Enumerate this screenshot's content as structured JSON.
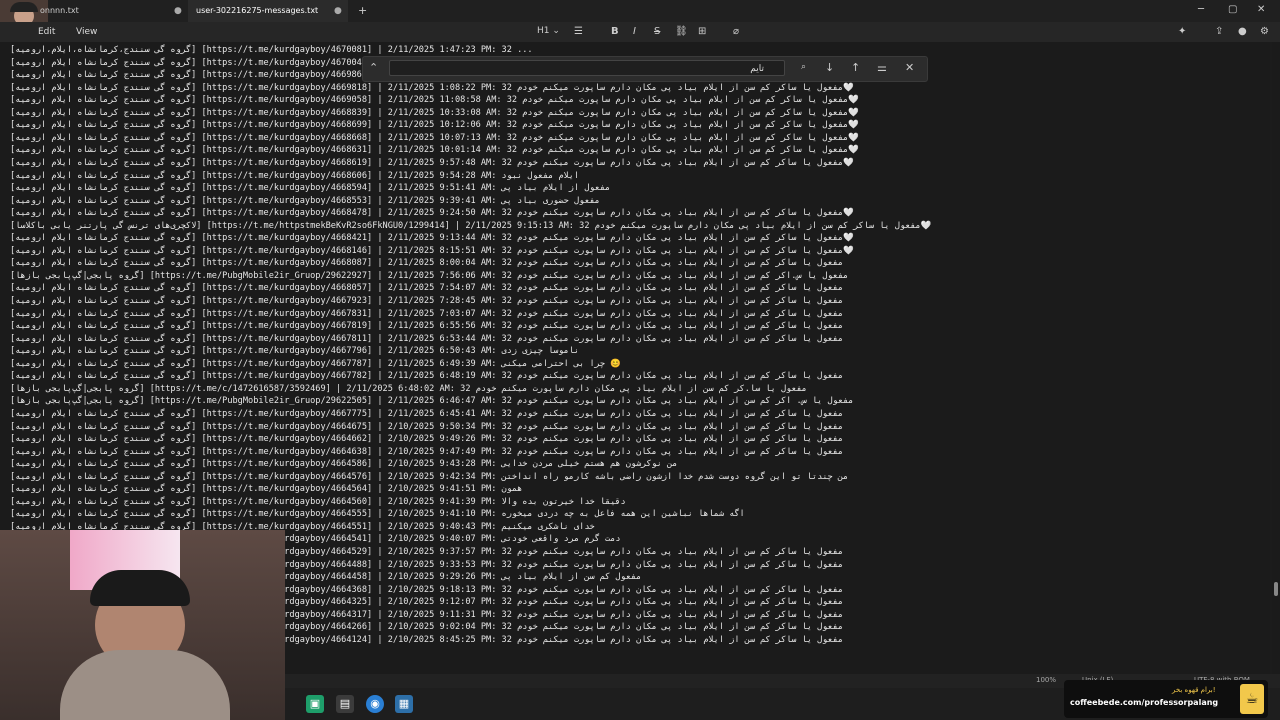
{
  "tabs": [
    {
      "label": "onnnn.txt"
    },
    {
      "label": "user-302216275-messages.txt"
    }
  ],
  "menu": {
    "edit": "Edit",
    "view": "View"
  },
  "toolbar": {
    "heading": "H1 ⌄"
  },
  "find": {
    "value": "تایم"
  },
  "editor_lines": [
    {
      "text": "[گروه گی سنندج،کرمانشاه،ایلام،ارومیه] [https://t.me/kurdgayboy/4670081] | 2/11/2025 1:47:23 PM: 32 ..."
    },
    {
      "text": "[گروه گی سنندج کرمانشاه ایلام ارومیه] [https://t.me/kurdgayboy/4670048] | 2/1"
    },
    {
      "text": "[گروه گی سنندج کرمانشاه ایلام ارومیه] [https://t.me/kurdgayboy/4669861] | 2/1"
    },
    {
      "text": "[گروه گی سنندج کرمانشاه ایلام ارومیه] [https://t.me/kurdgayboy/4669818] | 2/11/2025 1:08:22 PM: مفعول یا ساکر کم سن از ایلام بیاد پی مکان دارم ساپورت میکنم خودم 32🤍"
    },
    {
      "text": "[گروه گی سنندج کرمانشاه ایلام ارومیه] [https://t.me/kurdgayboy/4669058] | 2/11/2025 11:08:58 AM: مفعول یا ساکر کم سن از ایلام بیاد پی مکان دارم ساپورت میکنم خودم 32🤍"
    },
    {
      "text": "[گروه گی سنندج کرمانشاه ایلام ارومیه] [https://t.me/kurdgayboy/4668839] | 2/11/2025 10:33:08 AM: مفعول یا ساکر کم سن از ایلام بیاد پی مکان دارم ساپورت میکنم خودم 32🤍"
    },
    {
      "text": "[گروه گی سنندج کرمانشاه ایلام ارومیه] [https://t.me/kurdgayboy/4668699] | 2/11/2025 10:12:06 AM: مفعول یا ساکر کم سن از ایلام بیاد پی مکان دارم ساپورت میکنم خودم 32🤍"
    },
    {
      "text": "[گروه گی سنندج کرمانشاه ایلام ارومیه] [https://t.me/kurdgayboy/4668668] | 2/11/2025 10:07:13 AM: مفعول یا ساکر کم سن از ایلام بیاد پی مکان دارم ساپورت میکنم خودم 32🤍"
    },
    {
      "text": "[گروه گی سنندج کرمانشاه ایلام ارومیه] [https://t.me/kurdgayboy/4668631] | 2/11/2025 10:01:14 AM: مفعول یا ساکر کم سن از ایلام بیاد پی مکان دارم ساپورت میکنم خودم 32🤍"
    },
    {
      "text": "[گروه گی سنندج کرمانشاه ایلام ارومیه] [https://t.me/kurdgayboy/4668619] | 2/11/2025 9:57:48 AM: مفعول یا ساکر کم سن از ایلام بیاد پی مکان دارم ساپورت میکنم خودم 32🤍"
    },
    {
      "text": "[گروه گی سنندج کرمانشاه ایلام ارومیه] [https://t.me/kurdgayboy/4668606] | 2/11/2025 9:54:28 AM: ایلام مفعول نبود"
    },
    {
      "text": "[گروه گی سنندج کرمانشاه ایلام ارومیه] [https://t.me/kurdgayboy/4668594] | 2/11/2025 9:51:41 AM: مفعول از ایلام بیاد پی"
    },
    {
      "text": "[گروه گی سنندج کرمانشاه ایلام ارومیه] [https://t.me/kurdgayboy/4668553] | 2/11/2025 9:39:41 AM: مفعول حضوری بیاد پی"
    },
    {
      "text": "[گروه گی سنندج کرمانشاه ایلام ارومیه] [https://t.me/kurdgayboy/4668478] | 2/11/2025 9:24:50 AM: مفعول یا ساکر کم سن از ایلام بیاد پی مکان دارم ساپورت میکنم خودم 32🤍"
    },
    {
      "text": "[لاکچری‌های ترنس گی پارتنر یابی باکلاسا] [https://t.me/httpstmekBeKvR2so6FkNGU0/1299414] | 2/11/2025 9:15:13 AM: مفعول یا ساکر کم سن از ایلام بیاد پی مکان دارم ساپورت میکنم خودم 32🤍"
    },
    {
      "text": "[گروه گی سنندج کرمانشاه ایلام ارومیه] [https://t.me/kurdgayboy/4668421] | 2/11/2025 9:13:44 AM: مفعول یا ساکر کم سن از ایلام بیاد پی مکان دارم ساپورت میکنم خودم 32🤍"
    },
    {
      "text": "[گروه گی سنندج کرمانشاه ایلام ارومیه] [https://t.me/kurdgayboy/4668146] | 2/11/2025 8:15:51 AM: مفعول یا ساکر کم سن از ایلام بیاد پی مکان دارم ساپورت میکنم خودم 32🤍"
    },
    {
      "text": "[گروه گی سنندج کرمانشاه ایلام ارومیه] [https://t.me/kurdgayboy/4668087] | 2/11/2025 8:00:04 AM: مفعول یا ساکر کم سن از ایلام بیاد پی مکان دارم ساپورت میکنم خودم 32"
    },
    {
      "text": "[گروه پابجی|گپ‌پابجی بازها] [https://t.me/PubgMobile2ir_Gruop/29622927] | 2/11/2025 7:56:06 AM: مفعول یا س.اکر کم سن از ایلام بیاد پی مکان دارم ساپورت میکنم خودم 32"
    },
    {
      "text": "[گروه گی سنندج کرمانشاه ایلام ارومیه] [https://t.me/kurdgayboy/4668057] | 2/11/2025 7:54:07 AM: مفعول یا ساکر کم سن از ایلام بیاد پی مکان دارم ساپورت میکنم خودم 32"
    },
    {
      "text": "[گروه گی سنندج کرمانشاه ایلام ارومیه] [https://t.me/kurdgayboy/4667923] | 2/11/2025 7:28:45 AM: مفعول یا ساکر کم سن از ایلام بیاد پی مکان دارم ساپورت میکنم خودم 32"
    },
    {
      "text": "[گروه گی سنندج کرمانشاه ایلام ارومیه] [https://t.me/kurdgayboy/4667831] | 2/11/2025 7:03:07 AM: مفعول یا ساکر کم سن از ایلام بیاد پی مکان دارم ساپورت میکنم خودم 32"
    },
    {
      "text": "[گروه گی سنندج کرمانشاه ایلام ارومیه] [https://t.me/kurdgayboy/4667819] | 2/11/2025 6:55:56 AM: مفعول یا ساکر کم سن از ایلام بیاد پی مکان دارم ساپورت میکنم خودم 32"
    },
    {
      "text": "[گروه گی سنندج کرمانشاه ایلام ارومیه] [https://t.me/kurdgayboy/4667811] | 2/11/2025 6:53:44 AM: مفعول یا ساکر کم سن از ایلام بیاد پی مکان دارم ساپورت میکنم خودم 32"
    },
    {
      "text": "[گروه گی سنندج کرمانشاه ایلام ارومیه] [https://t.me/kurdgayboy/4667796] | 2/11/2025 6:50:43 AM: ناموسا چیزی زدی"
    },
    {
      "text": "[گروه گی سنندج کرمانشاه ایلام ارومیه] [https://t.me/kurdgayboy/4667787] | 2/11/2025 6:49:39 AM: چرا بی احترامی میکنی 😊"
    },
    {
      "text": "[گروه گی سنندج کرمانشاه ایلام ارومیه] [https://t.me/kurdgayboy/4667782] | 2/11/2025 6:48:19 AM: مفعول یا ساکر کم سن از ایلام بیاد پی مکان دارم ساپورت میکنم خودم 32"
    },
    {
      "text": "[گروه پابجی|گپ‌پابجی بازها] [https://t.me/c/1472616587/3592469] | 2/11/2025 6:48:02 AM: مفعول یا سا.کر کم سن از ایلام بیاد پی مکان دارم ساپورت میکنم خودم 32"
    },
    {
      "text": "[گروه پابجی|گپ‌پابجی بازها] [https://t.me/PubgMobile2ir_Gruop/29622505] | 2/11/2025 6:46:47 AM: مفعول یا س. اکر کم سن از ایلام بیاد پی مکان دارم ساپورت میکنم خودم 32"
    },
    {
      "text": "[گروه گی سنندج کرمانشاه ایلام ارومیه] [https://t.me/kurdgayboy/4667775] | 2/11/2025 6:45:41 AM: مفعول یا ساکر کم سن از ایلام بیاد پی مکان دارم ساپورت میکنم خودم 32"
    },
    {
      "text": "[گروه گی سنندج کرمانشاه ایلام ارومیه] [https://t.me/kurdgayboy/4664675] | 2/10/2025 9:50:34 PM: مفعول یا ساکر کم سن از ایلام بیاد پی مکان دارم ساپورت میکنم خودم 32"
    },
    {
      "text": "[گروه گی سنندج کرمانشاه ایلام ارومیه] [https://t.me/kurdgayboy/4664662] | 2/10/2025 9:49:26 PM: مفعول یا ساکر کم سن از ایلام بیاد پی مکان دارم ساپورت میکنم خودم 32"
    },
    {
      "text": "[گروه گی سنندج کرمانشاه ایلام ارومیه] [https://t.me/kurdgayboy/4664638] | 2/10/2025 9:47:49 PM: مفعول یا ساکر کم سن از ایلام بیاد پی مکان دارم ساپورت میکنم خودم 32"
    },
    {
      "text": "[گروه گی سنندج کرمانشاه ایلام ارومیه] [https://t.me/kurdgayboy/4664586] | 2/10/2025 9:43:28 PM: من نوکرشون هم هستم خیلی مردن خدایی"
    },
    {
      "text": "[گروه گی سنندج کرمانشاه ایلام ارومیه] [https://t.me/kurdgayboy/4664576] | 2/10/2025 9:42:34 PM: من چندتا تو این گروه دوست شدم خدا ازشون راضی باشه کارمو راه انداختن"
    },
    {
      "text": "[گروه گی سنندج کرمانشاه ایلام ارومیه] [https://t.me/kurdgayboy/4664564] | 2/10/2025 9:41:51 PM: همون"
    },
    {
      "text": "[گروه گی سنندج کرمانشاه ایلام ارومیه] [https://t.me/kurdgayboy/4664560] | 2/10/2025 9:41:39 PM: دقیقا خدا خیرتون بده والا"
    },
    {
      "text": "[گروه گی سنندج کرمانشاه ایلام ارومیه] [https://t.me/kurdgayboy/4664555] | 2/10/2025 9:41:10 PM: اگه شماها نباشین این همه فاعل به چه دردی میخوره"
    },
    {
      "text": "[گروه گی سنندج کرمانشاه ایلام ارومیه] [https://t.me/kurdgayboy/4664551] | 2/10/2025 9:40:43 PM: خدای ناشکری میکنیم"
    },
    {
      "text": "[گروه گی سنندج کرمانشاه ایلام ارومیه] [https://t.me/kurdgayboy/4664541] | 2/10/2025 9:40:07 PM: دمت گرم مرد واقعی خودتی"
    },
    {
      "text": "[گروه گی سنندج کرمانشاه ایلام ارومیه] [https://t.me/kurdgayboy/4664529] | 2/10/2025 9:37:57 PM: مفعول یا ساکر کم سن از ایلام بیاد پی مکان دارم ساپورت میکنم خودم 32"
    },
    {
      "text": "[گروه گی سنندج کرمانشاه ایلام ارومیه] [https://t.me/kurdgayboy/4664488] | 2/10/2025 9:33:53 PM: مفعول یا ساکر کم سن از ایلام بیاد پی مکان دارم ساپورت میکنم خودم 32"
    },
    {
      "text": "[گروه گی سنندج کرمانشاه ایلام ارومیه] [https://t.me/kurdgayboy/4664458] | 2/10/2025 9:29:26 PM: مفعول کم سن از ایلام بیاد پی"
    },
    {
      "text": "[گروه گی سنندج کرمانشاه ایلام ارومیه] [https://t.me/kurdgayboy/4664368] | 2/10/2025 9:18:13 PM: مفعول یا ساکر کم سن از ایلام بیاد پی مکان دارم ساپورت میکنم خودم 32"
    },
    {
      "text": "[گروه گی سنندج کرمانشاه ایلام ارومیه] [https://t.me/kurdgayboy/4664325] | 2/10/2025 9:12:07 PM: مفعول یا ساکر کم سن از ایلام بیاد پی مکان دارم ساپورت میکنم خودم 32"
    },
    {
      "text": "[گروه گی سنندج کرمانشاه ایلام ارومیه] [https://t.me/kurdgayboy/4664317] | 2/10/2025 9:11:31 PM: مفعول یا ساکر کم سن از ایلام بیاد پی مکان دارم ساپورت میکنم خودم 32"
    },
    {
      "text": "[گروه گی سنندج کرمانشاه ایلام ارومیه] [https://t.me/kurdgayboy/4664266] | 2/10/2025 9:02:04 PM: مفعول یا ساکر کم سن از ایلام بیاد پی مکان دارم ساپورت میکنم خودم 32"
    },
    {
      "text": "[گروه گی سنندج کرمانشاه ایلام ارومیه] [https://t.me/kurdgayboy/4664124] | 2/10/2025 8:45:25 PM: مفعول یا ساکر کم سن از ایلام بیاد پی مکان دارم ساپورت میکنم خودم 32"
    }
  ],
  "statusbar": {
    "zoom": "100%",
    "eol": "Unix (LF)",
    "encoding": "UTF-8 with BOM"
  },
  "banner": {
    "line1": "برام قهوه بخر!",
    "line2": "coffeebede.com/professorpalang"
  }
}
